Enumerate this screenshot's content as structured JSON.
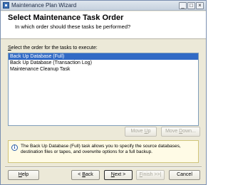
{
  "window": {
    "title": "Maintenance Plan Wizard",
    "controls": {
      "minimize": "_",
      "maximize": "□",
      "close": "×"
    }
  },
  "header": {
    "title": "Select Maintenance Task Order",
    "subtitle": "In which order should these tasks be performed?"
  },
  "task_list": {
    "label_prefix": "S",
    "label_rest": "elect the order for the tasks to execute:",
    "items": [
      {
        "label": "Back Up Database (Full)",
        "selected": true
      },
      {
        "label": "Back Up Database (Transaction Log)",
        "selected": false
      },
      {
        "label": "Maintenance Cleanup Task",
        "selected": false
      }
    ]
  },
  "order_buttons": {
    "move_up_prefix": "Move ",
    "move_up_key": "U",
    "move_up_rest": "p",
    "move_down_prefix": "Move ",
    "move_down_key": "D",
    "move_down_rest": "own..."
  },
  "info": {
    "icon": "info-icon",
    "text": "The Back Up Database (Full) task allows you to specify the source databases, destination files or tapes, and overwrite options for a full backup."
  },
  "footer": {
    "help_key": "H",
    "help_rest": "elp",
    "back_prefix": "< ",
    "back_key": "B",
    "back_rest": "ack",
    "next_key": "N",
    "next_rest": "ext >",
    "finish_key": "F",
    "finish_rest": "inish",
    "finish_suffix": " >>|",
    "cancel": "Cancel"
  }
}
